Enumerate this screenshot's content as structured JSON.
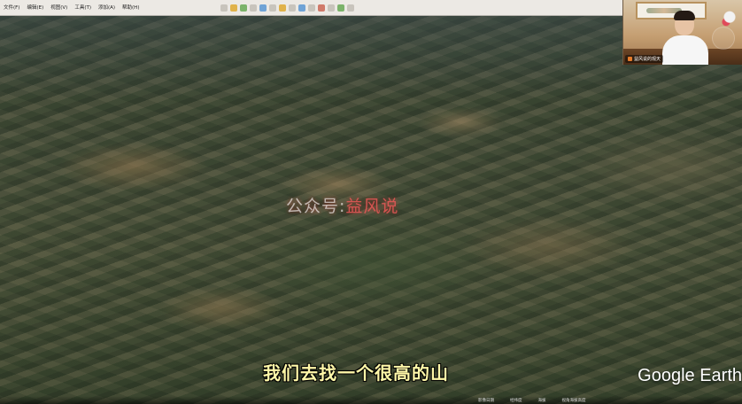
{
  "menu": {
    "items": [
      "文件(F)",
      "编辑(E)",
      "视图(V)",
      "工具(T)",
      "添加(A)",
      "帮助(H)"
    ]
  },
  "webcam": {
    "name_tag": "益风说的观天"
  },
  "watermark": {
    "prefix": "公众号:",
    "name": "益风说"
  },
  "subtitle": {
    "text": "我们去找一个很高的山"
  },
  "brand": {
    "text": "Google Earth"
  },
  "status": {
    "items": [
      "影像日期",
      "经纬度",
      "海拔",
      "视角海拔高度"
    ]
  }
}
